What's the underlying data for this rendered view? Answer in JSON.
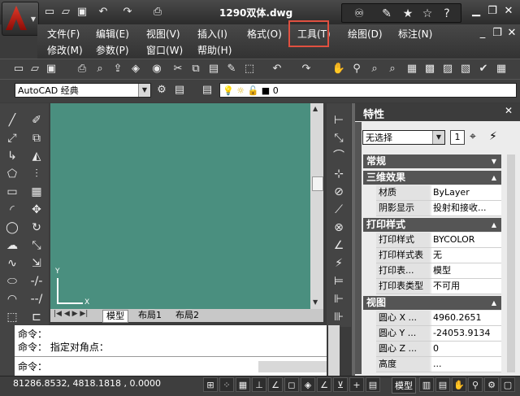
{
  "titlebar": {
    "title": "1290双体.dwg",
    "quick_access_icons": [
      "new-icon",
      "open-icon",
      "save-icon",
      "undo-icon",
      "redo-icon",
      "print-icon"
    ],
    "infocenter_icons": [
      "binoculars-icon",
      "satellite-icon",
      "star-icon",
      "help-icon"
    ]
  },
  "menubar": {
    "row1": [
      "文件(F)",
      "编辑(E)",
      "视图(V)",
      "插入(I)",
      "格式(O)",
      "工具(T)",
      "绘图(D)",
      "标注(N)"
    ],
    "row2": [
      "修改(M)",
      "参数(P)",
      "窗口(W)",
      "帮助(H)"
    ],
    "highlighted": "工具(T)"
  },
  "workspace": {
    "value": "AutoCAD 经典"
  },
  "layer": {
    "value": "0"
  },
  "canvas": {
    "tabs": [
      "模型",
      "布局1",
      "布局2"
    ],
    "axis_y": "Y",
    "axis_x": "X"
  },
  "command": {
    "lines": [
      "命令：",
      "命令：  指定对角点："
    ],
    "prompt": "命令："
  },
  "properties": {
    "title": "特性",
    "selection": "无选择",
    "sections": {
      "general": "常规",
      "3d": "三维效果",
      "plot": "打印样式",
      "view": "视图"
    },
    "rows_3d": [
      {
        "k": "材质",
        "v": "ByLayer"
      },
      {
        "k": "阴影显示",
        "v": "投射和接收..."
      }
    ],
    "rows_plot": [
      {
        "k": "打印样式",
        "v": "BYCOLOR"
      },
      {
        "k": "打印样式表",
        "v": "无"
      },
      {
        "k": "打印表...",
        "v": "模型"
      },
      {
        "k": "打印表类型",
        "v": "不可用"
      }
    ],
    "rows_view": [
      {
        "k": "圆心 X ...",
        "v": "4960.2651"
      },
      {
        "k": "圆心 Y ...",
        "v": "-24053.9134"
      },
      {
        "k": "圆心 Z ...",
        "v": "0"
      },
      {
        "k": "高度",
        "v": "..."
      }
    ]
  },
  "status": {
    "coords": "81286.8532, 4818.1818 , 0.0000",
    "model": "模型"
  },
  "colors": {
    "canvas": "#4a8f7f",
    "highlight_box": "#e05040"
  }
}
